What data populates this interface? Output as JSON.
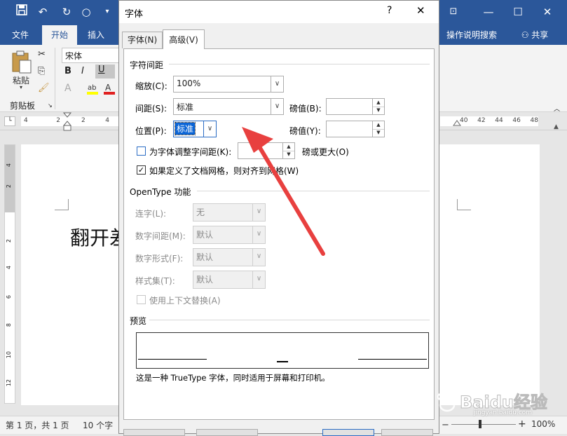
{
  "word": {
    "ribbon_tabs": [
      "文件",
      "开始",
      "插入"
    ],
    "active_tab": "开始",
    "help_search": "操作说明搜索",
    "share": "共享",
    "font_name": "宋体",
    "paste_label": "粘贴",
    "clipboard_label": "剪贴板",
    "format_buttons": [
      "B",
      "I",
      "U"
    ],
    "ruler_numbers_left": [
      "4",
      "2",
      "2",
      "4"
    ],
    "ruler_numbers_right": [
      "40",
      "42",
      "44",
      "46",
      "48"
    ],
    "vruler_numbers": [
      "4",
      "2",
      "2",
      "4",
      "6",
      "8",
      "10",
      "12"
    ],
    "doc_text": "翻开差",
    "status_page": "第 1 页，共 1 页",
    "status_words": "10 个字",
    "zoom": "100%"
  },
  "dialog": {
    "title": "字体",
    "help": "?",
    "close": "✕",
    "tabs": [
      "字体(N)",
      "高级(V)"
    ],
    "active_tab": "高级(V)",
    "char_spacing": {
      "section": "字符间距",
      "scale_label": "缩放(C):",
      "scale_value": "100%",
      "spacing_label": "间距(S):",
      "spacing_value": "标准",
      "spacing_pt_label": "磅值(B):",
      "spacing_pt_value": "",
      "position_label": "位置(P):",
      "position_value": "标准",
      "position_pt_label": "磅值(Y):",
      "position_pt_value": "",
      "kerning_label": "为字体调整字间距(K):",
      "kerning_checked": false,
      "kerning_value": "",
      "kerning_suffix": "磅或更大(O)",
      "grid_label": "如果定义了文档网格，则对齐到网格(W)",
      "grid_checked": true
    },
    "opentype": {
      "section": "OpenType 功能",
      "ligatures_label": "连字(L):",
      "ligatures_value": "无",
      "num_spacing_label": "数字间距(M):",
      "num_spacing_value": "默认",
      "num_form_label": "数字形式(F):",
      "num_form_value": "默认",
      "style_set_label": "样式集(T):",
      "style_set_value": "默认",
      "contextual_label": "使用上下文替换(A)",
      "contextual_checked": false
    },
    "preview": {
      "section": "预览",
      "note": "这是一种 TrueType 字体，同时适用于屏幕和打印机。"
    }
  },
  "watermark": {
    "brand": "Baidu经验",
    "url": "jingyan.baidu.com"
  },
  "colors": {
    "word_blue": "#2b579a",
    "arrow_red": "#e8403f",
    "check_blue": "#2b6cc4"
  }
}
